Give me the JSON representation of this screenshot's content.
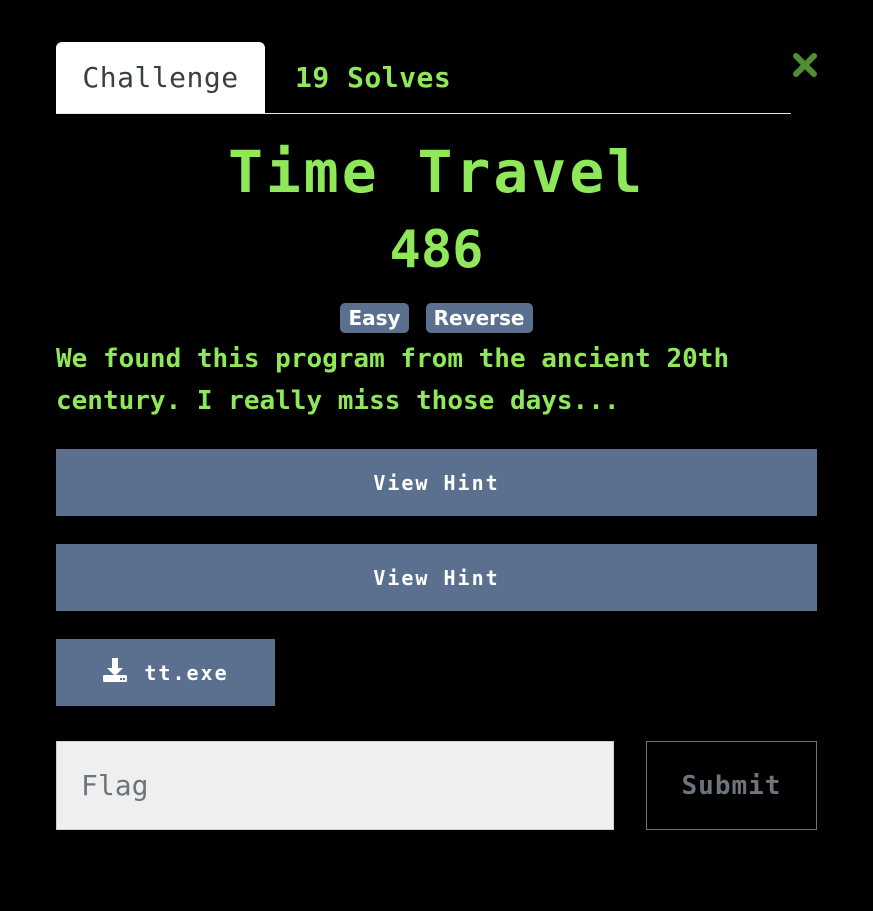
{
  "tabs": [
    {
      "label": "Challenge",
      "active": true
    },
    {
      "label": "19 Solves",
      "active": false
    }
  ],
  "close_icon": "close-x-icon",
  "challenge": {
    "name": "Time Travel",
    "points": "486",
    "tags": [
      "Easy",
      "Reverse"
    ],
    "description": "We found this program from the ancient 20th century. I really miss those days..."
  },
  "hints": [
    {
      "label": "View Hint"
    },
    {
      "label": "View Hint"
    }
  ],
  "file": {
    "icon": "download-icon",
    "name": "tt.exe"
  },
  "flag_form": {
    "placeholder": "Flag",
    "value": "",
    "submit_label": "Submit"
  },
  "colors": {
    "background": "#000000",
    "accent_green": "#8fe85a",
    "button_blue": "#5b708f",
    "close_green": "#4f8f2f"
  }
}
